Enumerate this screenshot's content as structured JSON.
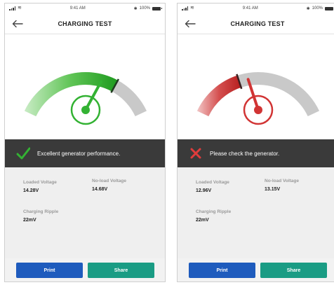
{
  "status_bar": {
    "time": "9:41 AM",
    "battery": "100%"
  },
  "colors": {
    "good": "#33b233",
    "bad": "#d13434",
    "print_button": "#1e5bbd",
    "share_button": "#1a9c84",
    "message_bar": "#3a3a3a"
  },
  "screens": [
    {
      "title": "CHARGING TEST",
      "gauge_level": 0.72,
      "status": "good",
      "status_icon": "checkmark-icon",
      "message": "Excellent generator performance.",
      "loaded_voltage_label": "Loaded Voltage",
      "loaded_voltage": "14.28V",
      "no_load_voltage_label": "No-load Voltage",
      "no_load_voltage": "14.68V",
      "charging_ripple_label": "Charging Ripple",
      "charging_ripple": "22mV",
      "print_label": "Print",
      "share_label": "Share"
    },
    {
      "title": "CHARGING TEST",
      "gauge_level": 0.36,
      "status": "bad",
      "status_icon": "cross-icon",
      "message": "Please check the generator.",
      "loaded_voltage_label": "Loaded Voltage",
      "loaded_voltage": "12.96V",
      "no_load_voltage_label": "No-load Voltage",
      "no_load_voltage": "13.15V",
      "charging_ripple_label": "Charging Ripple",
      "charging_ripple": "22mV",
      "print_label": "Print",
      "share_label": "Share"
    }
  ]
}
